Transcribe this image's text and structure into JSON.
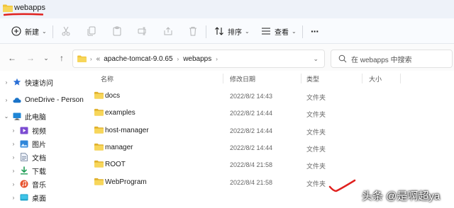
{
  "window": {
    "title": "webapps"
  },
  "toolbar": {
    "new_label": "新建",
    "sort_label": "排序",
    "view_label": "查看",
    "more_label": "···"
  },
  "address": {
    "overflow": "«",
    "crumbs": [
      "apache-tomcat-9.0.65",
      "webapps"
    ]
  },
  "search": {
    "placeholder": "在 webapps 中搜索"
  },
  "sidebar": {
    "items": [
      {
        "label": "快速访问",
        "icon": "star-icon"
      },
      {
        "label": "OneDrive - Persona",
        "icon": "cloud-icon"
      },
      {
        "label": "此电脑",
        "icon": "pc-icon"
      },
      {
        "label": "视频",
        "icon": "video-icon"
      },
      {
        "label": "图片",
        "icon": "picture-icon"
      },
      {
        "label": "文档",
        "icon": "document-icon"
      },
      {
        "label": "下载",
        "icon": "download-icon"
      },
      {
        "label": "音乐",
        "icon": "music-icon"
      },
      {
        "label": "桌面",
        "icon": "desktop-icon"
      }
    ]
  },
  "columns": {
    "name": "名称",
    "date": "修改日期",
    "type": "类型",
    "size": "大小"
  },
  "files": [
    {
      "name": "docs",
      "date": "2022/8/2 14:43",
      "type": "文件夹"
    },
    {
      "name": "examples",
      "date": "2022/8/2 14:44",
      "type": "文件夹"
    },
    {
      "name": "host-manager",
      "date": "2022/8/2 14:44",
      "type": "文件夹"
    },
    {
      "name": "manager",
      "date": "2022/8/2 14:44",
      "type": "文件夹"
    },
    {
      "name": "ROOT",
      "date": "2022/8/4 21:58",
      "type": "文件夹"
    },
    {
      "name": "WebProgram",
      "date": "2022/8/4 21:58",
      "type": "文件夹"
    }
  ],
  "watermark": "头条 @是啊超ya",
  "colors": {
    "folder": "#f0c43a",
    "folder_dark": "#d9a520",
    "accent": "#1a73c8",
    "annotation": "#e0201e"
  }
}
